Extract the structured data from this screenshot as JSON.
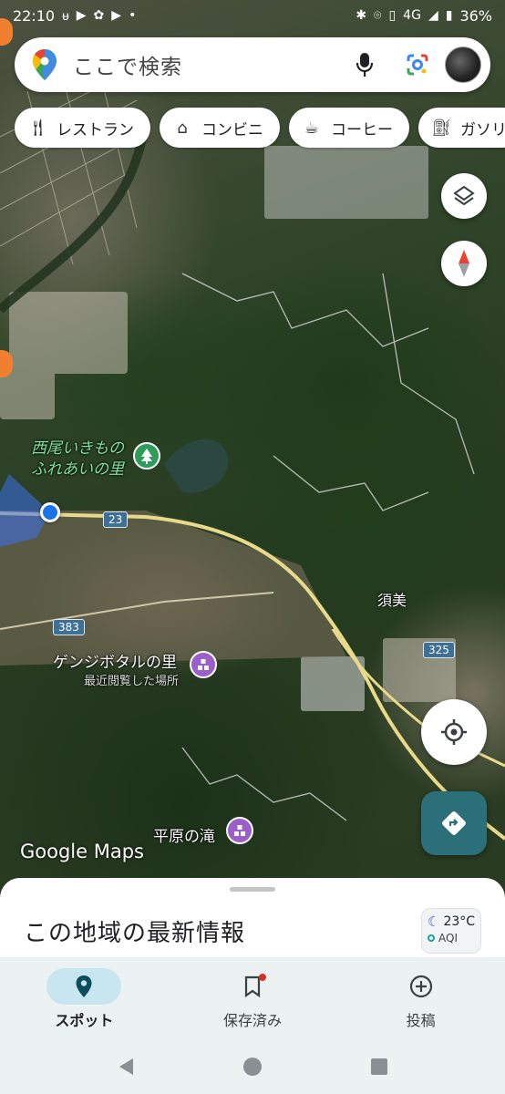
{
  "status_bar": {
    "time": "22:10",
    "battery": "36%",
    "network": "4G"
  },
  "search": {
    "placeholder": "ここで検索"
  },
  "chips": [
    {
      "label": "レストラン",
      "icon": "fork-knife-icon"
    },
    {
      "label": "コンビニ",
      "icon": "store-icon"
    },
    {
      "label": "コーヒー",
      "icon": "coffee-icon"
    },
    {
      "label": "ガソリ",
      "icon": "gas-station-icon"
    }
  ],
  "map": {
    "poi_park": "西尾いきもの\nふれあいの里",
    "poi_park_line1": "西尾いきもの",
    "poi_park_line2": "ふれあいの里",
    "poi_genji": "ゲンジボタルの里",
    "poi_genji_sub": "最近閲覧した場所",
    "poi_waterfall": "平原の滝",
    "town": "須美",
    "route_23": "23",
    "route_383": "383",
    "route_325": "325",
    "logo": "Google Maps"
  },
  "sheet": {
    "title": "この地域の最新情報"
  },
  "weather": {
    "temperature": "23°C",
    "aqi_label": "AQI"
  },
  "bottom_nav": [
    {
      "label": "スポット",
      "icon": "pin-icon",
      "active": true
    },
    {
      "label": "保存済み",
      "icon": "bookmark-icon",
      "active": false
    },
    {
      "label": "投稿",
      "icon": "add-circle-icon",
      "active": false
    }
  ],
  "colors": {
    "accent": "#2b6f78",
    "active_tab_bg": "#c8e6f0",
    "poi_green": "#7fe3a0",
    "poi_purple": "#9c5fc9"
  }
}
